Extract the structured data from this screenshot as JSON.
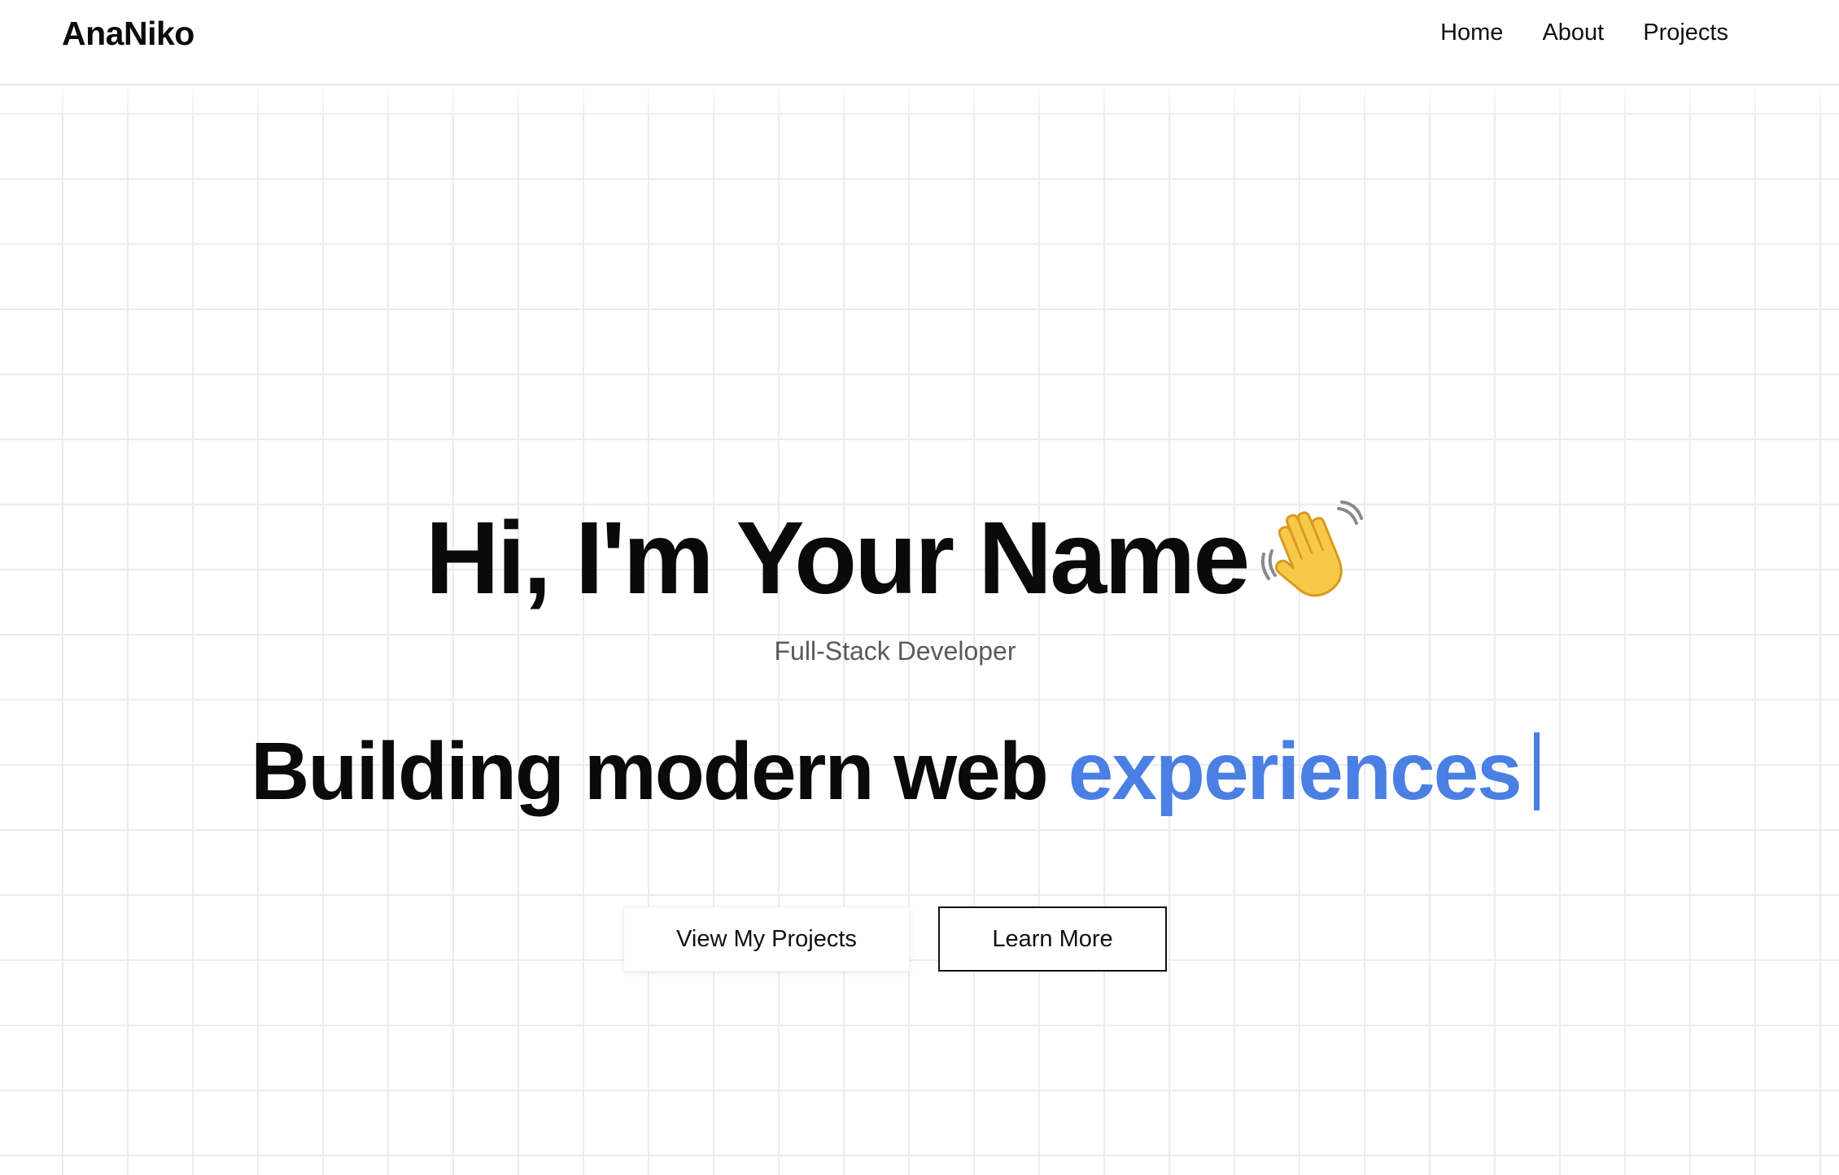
{
  "header": {
    "brand": "AnaNiko",
    "nav": [
      "Home",
      "About",
      "Projects"
    ]
  },
  "hero": {
    "greeting": "Hi, I'm Your Name",
    "greeting_icon": "waving-hand-icon",
    "role": "Full-Stack Developer",
    "tagline_prefix": "Building modern web",
    "tagline_highlight": "experiences",
    "buttons": {
      "primary": "View My Projects",
      "secondary": "Learn More"
    }
  },
  "colors": {
    "accent": "#4a7fe3",
    "text": "#0a0a0a",
    "muted": "#5a5a5a",
    "grid": "#ececec"
  }
}
